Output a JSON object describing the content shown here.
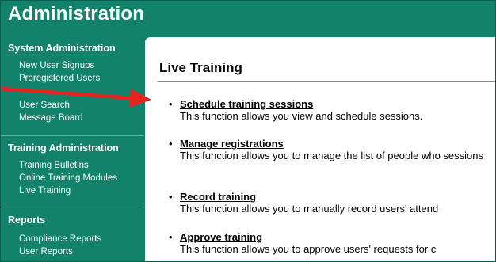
{
  "app": {
    "title": "Administration"
  },
  "sidebar": {
    "sections": [
      {
        "heading": "System Administration",
        "items": [
          "New User Signups",
          "Preregistered Users",
          "User Search",
          "Message Board"
        ]
      },
      {
        "heading": "Training Administration",
        "items": [
          "Training Bulletins",
          "Online Training Modules",
          "Live Training"
        ]
      },
      {
        "heading": "Reports",
        "items": [
          "Compliance Reports",
          "User Reports"
        ]
      }
    ]
  },
  "panel": {
    "title": "Live Training",
    "entries": [
      {
        "link": "Schedule training sessions",
        "desc": "This function allows you view and schedule sessions."
      },
      {
        "link": "Manage registrations",
        "desc": "This function allows you to manage the list of people who sessions"
      },
      {
        "link": "Record training",
        "desc": "This function allows you to manually record users' attend"
      },
      {
        "link": "Approve training",
        "desc": "This function allows you to approve users' requests for c"
      }
    ]
  },
  "colors": {
    "background": "#12826a",
    "panel": "#ffffff",
    "annotation_arrow": "#e8231f"
  }
}
